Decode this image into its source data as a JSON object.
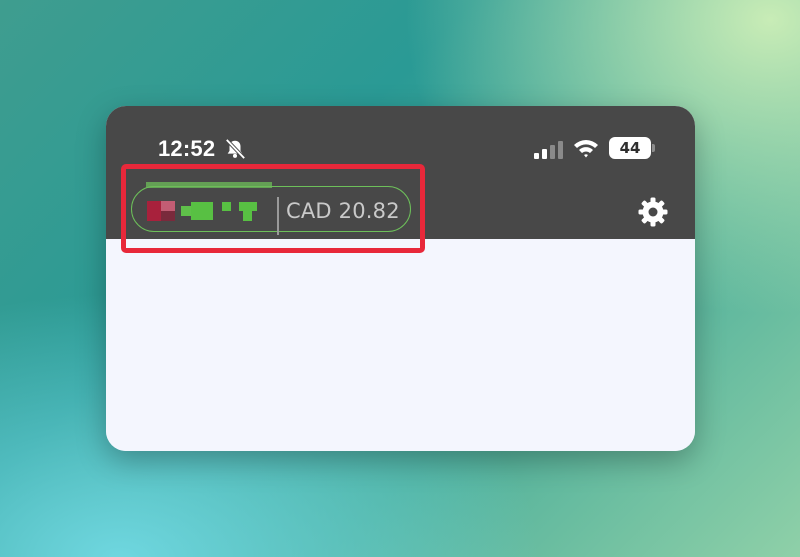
{
  "status_bar": {
    "time": "12:52",
    "silent_icon": "bell-slash-icon",
    "signal_icon": "cellular-signal-icon",
    "wifi_icon": "wifi-icon",
    "battery_level": "44"
  },
  "header": {
    "account_name_redacted": true,
    "balance": "CAD 20.82",
    "settings_icon": "gear-icon"
  },
  "colors": {
    "header_bg": "#484848",
    "content_bg": "#f4f6fe",
    "pill_border": "#6dc05a",
    "highlight": "#e8283a"
  }
}
